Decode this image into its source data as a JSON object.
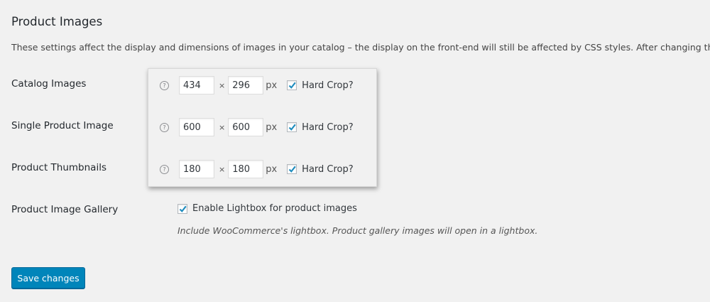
{
  "section": {
    "title": "Product Images",
    "description": "These settings affect the display and dimensions of images in your catalog – the display on the front-end will still be affected by CSS styles. After changing these set"
  },
  "rows": [
    {
      "label": "Catalog Images",
      "width": "434",
      "height": "296",
      "unit": "px",
      "hard_crop_label": "Hard Crop?",
      "hard_crop": true
    },
    {
      "label": "Single Product Image",
      "width": "600",
      "height": "600",
      "unit": "px",
      "hard_crop_label": "Hard Crop?",
      "hard_crop": true
    },
    {
      "label": "Product Thumbnails",
      "width": "180",
      "height": "180",
      "unit": "px",
      "hard_crop_label": "Hard Crop?",
      "hard_crop": true
    }
  ],
  "gallery": {
    "label": "Product Image Gallery",
    "checkbox_label": "Enable Lightbox for product images",
    "checked": true,
    "description": "Include WooCommerce's lightbox. Product gallery images will open in a lightbox."
  },
  "dimension_separator": "×",
  "help_glyph": "?",
  "save_button": {
    "label": "Save changes"
  },
  "colors": {
    "background": "#f1f1f1",
    "primary_button": "#0085ba",
    "checkmark": "#1e8cbe"
  },
  "icons": {
    "help": "help-circle-icon",
    "check": "checkmark-icon"
  }
}
